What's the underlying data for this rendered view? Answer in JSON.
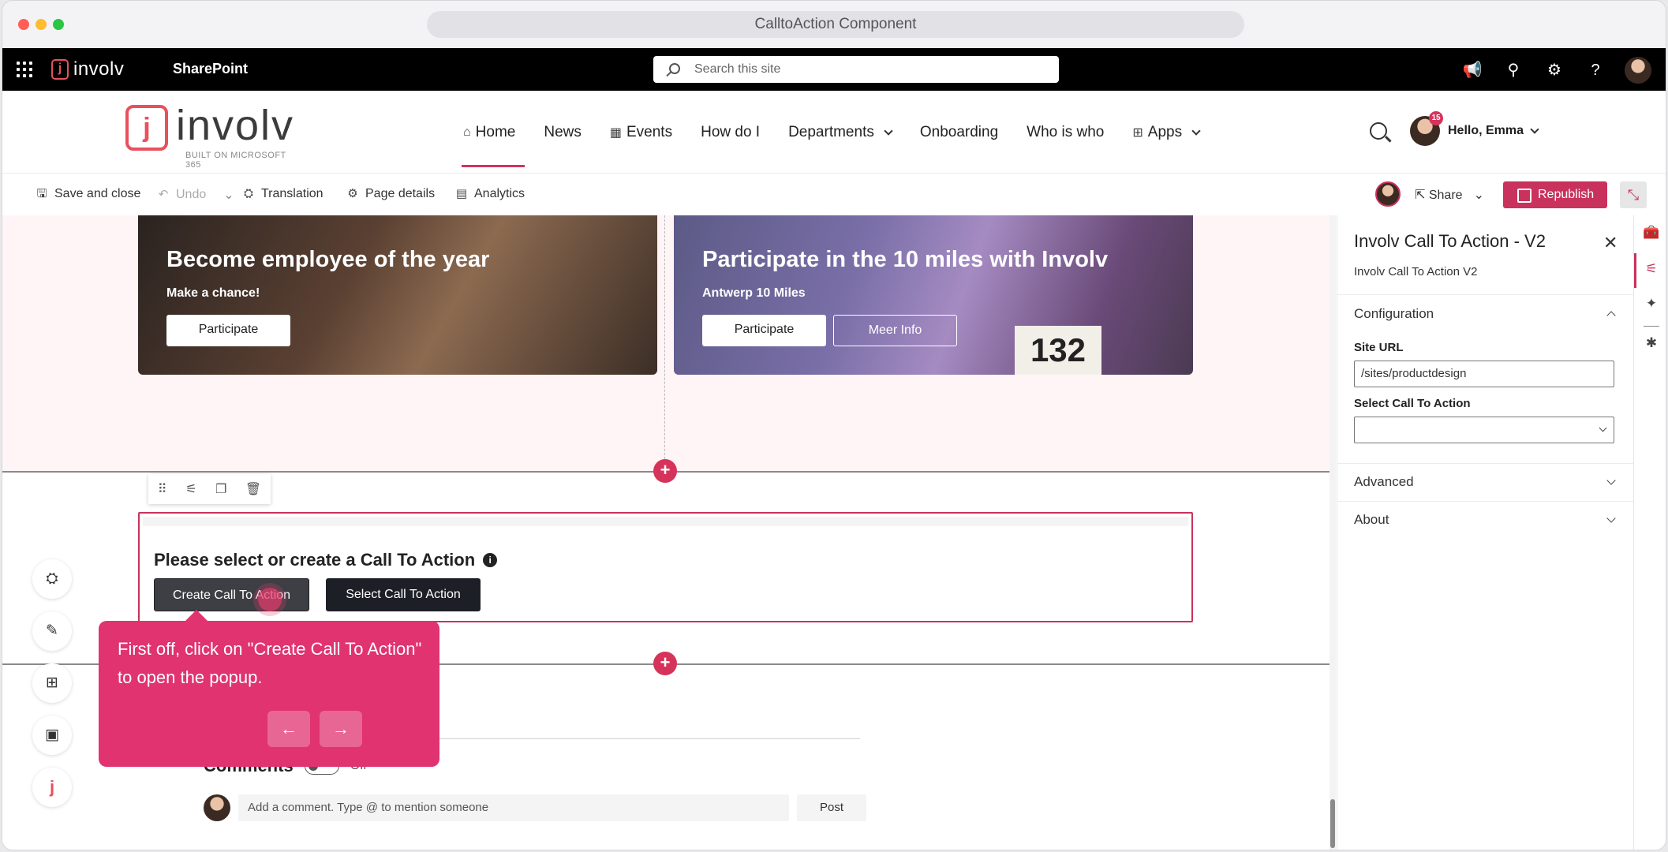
{
  "window": {
    "title": "CalltoAction Component"
  },
  "suite_bar": {
    "logo_text": "involv",
    "app_name": "SharePoint",
    "search_placeholder": "Search this site",
    "icons": [
      "megaphone-icon",
      "share-network-icon",
      "settings-icon",
      "help-icon",
      "avatar"
    ]
  },
  "site_header": {
    "logo_text": "involv",
    "logo_subtitle": "BUILT ON MICROSOFT 365",
    "nav": [
      {
        "label": "Home",
        "icon": "home-icon"
      },
      {
        "label": "News"
      },
      {
        "label": "Events",
        "icon": "calendar-icon"
      },
      {
        "label": "How do I"
      },
      {
        "label": "Departments",
        "dropdown": true
      },
      {
        "label": "Onboarding"
      },
      {
        "label": "Who is who"
      },
      {
        "label": "Apps",
        "icon": "apps-icon",
        "dropdown": true
      }
    ],
    "user": {
      "greeting": "Hello, Emma",
      "badge": "15"
    }
  },
  "command_bar": {
    "save_close": "Save and close",
    "undo": "Undo",
    "translation": "Translation",
    "page_details": "Page details",
    "analytics": "Analytics",
    "share": "Share",
    "republish": "Republish"
  },
  "hero_tiles": [
    {
      "title": "Become employee of the year",
      "subtitle": "Make a chance!",
      "buttons": [
        "Participate"
      ]
    },
    {
      "title": "Participate in the 10 miles with Involv",
      "subtitle": "Antwerp 10 Miles",
      "buttons": [
        "Participate",
        "Meer Info"
      ],
      "bib_number": "132"
    }
  ],
  "cta_webpart": {
    "heading": "Please select or create a Call To Action",
    "info_glyph": "i",
    "create_button": "Create Call To Action",
    "select_button": "Select Call To Action"
  },
  "tooltip": {
    "text": "First off, click on \"Create Call To Action\" to open the popup.",
    "prev": "←",
    "next": "→"
  },
  "comments": {
    "title": "Comments",
    "toggle_state": "Off",
    "input_placeholder": "Add a comment. Type @ to mention someone",
    "post": "Post"
  },
  "property_pane": {
    "title": "Involv Call To Action - V2",
    "subtitle": "Involv Call To Action V2",
    "groups": {
      "configuration": "Configuration",
      "advanced": "Advanced",
      "about": "About"
    },
    "site_url_label": "Site URL",
    "site_url_value": "/sites/productdesign",
    "select_cta_label": "Select Call To Action",
    "select_cta_value": ""
  },
  "colors": {
    "accent": "#c9325c",
    "tooltip": "#e0336f",
    "brand_logo": "#e8505b"
  }
}
